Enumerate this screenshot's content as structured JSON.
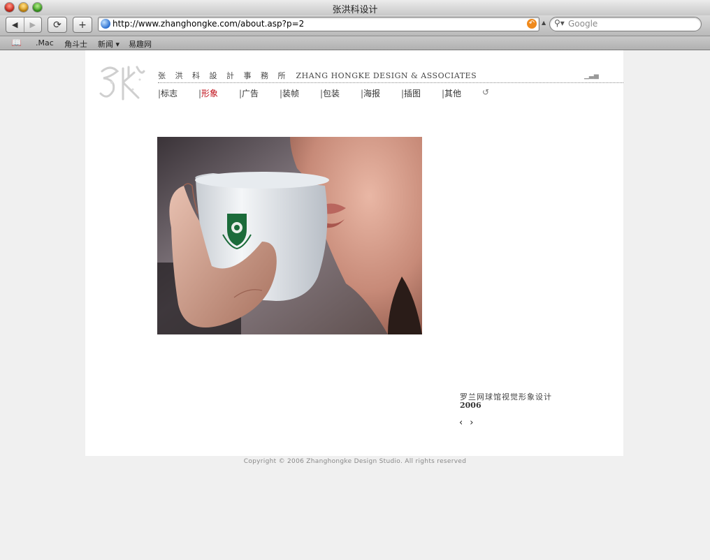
{
  "window": {
    "title": "张洪科设计"
  },
  "toolbar": {
    "back_icon": "◀",
    "forward_icon": "▶",
    "reload_icon": "⟳",
    "add_icon": "+",
    "url": "http://www.zhanghongke.com/about.asp?p=2",
    "search_placeholder": "Google"
  },
  "bookmarks": [
    ".Mac",
    "角斗士",
    "新闻 ▾",
    "易趣网"
  ],
  "site": {
    "title_cn": "张 洪 科 設 計 事 務 所",
    "title_en": "ZHANG HONGKE DESIGN & ASSOCIATES",
    "menu": [
      "标志",
      "形象",
      "广告",
      "装帧",
      "包装",
      "海报",
      "插图",
      "其他"
    ],
    "active_menu_index": 1,
    "refresh_icon": "↺",
    "caption": "罗兰网球馆视觉形象设计",
    "year": "2006",
    "prev": "‹",
    "next": "›",
    "footer": "Copyright © 2006 Zhanghongke Design Studio. All rights reserved"
  },
  "colors": {
    "active_menu": "#c0101a",
    "page_bg": "#f0f0f0"
  }
}
